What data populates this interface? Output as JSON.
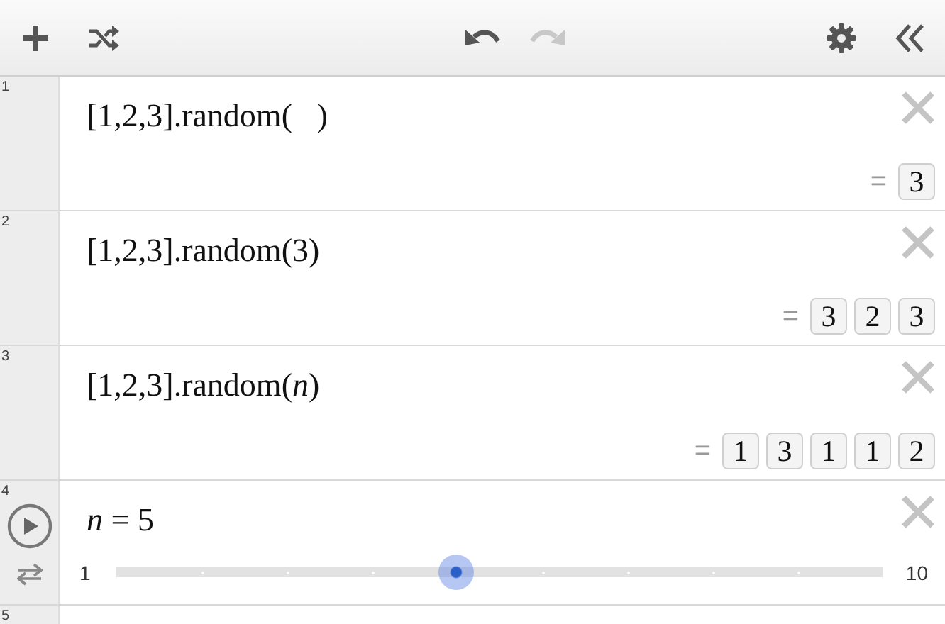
{
  "expressions": [
    {
      "number": "1",
      "kind": "expression",
      "latex": "[1,2,3].random(  )",
      "equals": "=",
      "results": [
        "3"
      ]
    },
    {
      "number": "2",
      "kind": "expression",
      "latex": "[1,2,3].random(3)",
      "equals": "=",
      "results": [
        "3",
        "2",
        "3"
      ]
    },
    {
      "number": "3",
      "kind": "expression",
      "latex": "[1,2,3].random(*n*)",
      "equals": "=",
      "results": [
        "1",
        "3",
        "1",
        "1",
        "2"
      ]
    },
    {
      "number": "4",
      "kind": "slider",
      "latex": "*n* = 5",
      "min": "1",
      "max": "10",
      "level": 0.444
    },
    {
      "number": "5",
      "kind": "empty"
    }
  ]
}
